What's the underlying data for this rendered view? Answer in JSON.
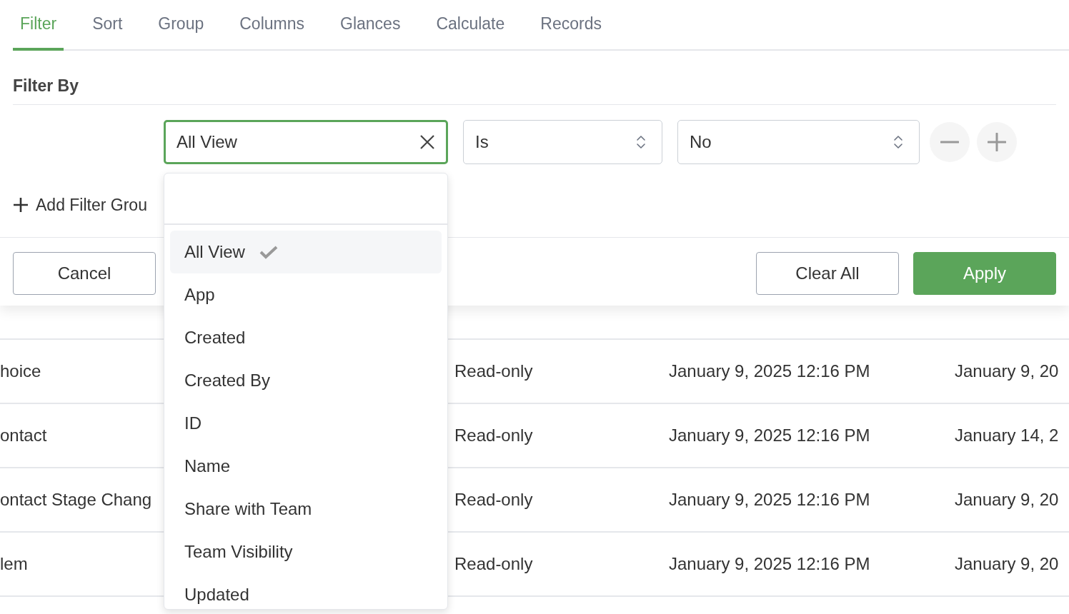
{
  "tabs": [
    {
      "label": "Filter",
      "selected": true
    },
    {
      "label": "Sort",
      "selected": false
    },
    {
      "label": "Group",
      "selected": false
    },
    {
      "label": "Columns",
      "selected": false
    },
    {
      "label": "Glances",
      "selected": false
    },
    {
      "label": "Calculate",
      "selected": false
    },
    {
      "label": "Records",
      "selected": false
    }
  ],
  "filter": {
    "title": "Filter By",
    "field": "All View",
    "operator": "Is",
    "value": "No",
    "add_group": "Add Filter Grou"
  },
  "dropdown": {
    "options": [
      {
        "label": "All View",
        "selected": true
      },
      {
        "label": "App",
        "selected": false
      },
      {
        "label": "Created",
        "selected": false
      },
      {
        "label": "Created By",
        "selected": false
      },
      {
        "label": "ID",
        "selected": false
      },
      {
        "label": "Name",
        "selected": false
      },
      {
        "label": "Share with Team",
        "selected": false
      },
      {
        "label": "Team Visibility",
        "selected": false
      },
      {
        "label": "Updated",
        "selected": false
      }
    ]
  },
  "buttons": [
    {
      "label": "Cancel",
      "kind": "secondary"
    },
    {
      "label": "Clear All",
      "kind": "secondary"
    },
    {
      "label": "Apply",
      "kind": "primary"
    }
  ],
  "table": {
    "rows": [
      {
        "cells": [
          "hoice",
          "Read-only",
          "January 9, 2025 12:16 PM",
          "January 9, 20"
        ]
      },
      {
        "cells": [
          "ontact",
          "Read-only",
          "January 9, 2025 12:16 PM",
          "January 14, 2"
        ]
      },
      {
        "cells": [
          "ontact Stage Chang",
          "Read-only",
          "January 9, 2025 12:16 PM",
          "January 9, 20"
        ]
      },
      {
        "cells": [
          "lem",
          "Read-only",
          "January 9, 2025 12:16 PM",
          "January 9, 20"
        ]
      }
    ]
  }
}
